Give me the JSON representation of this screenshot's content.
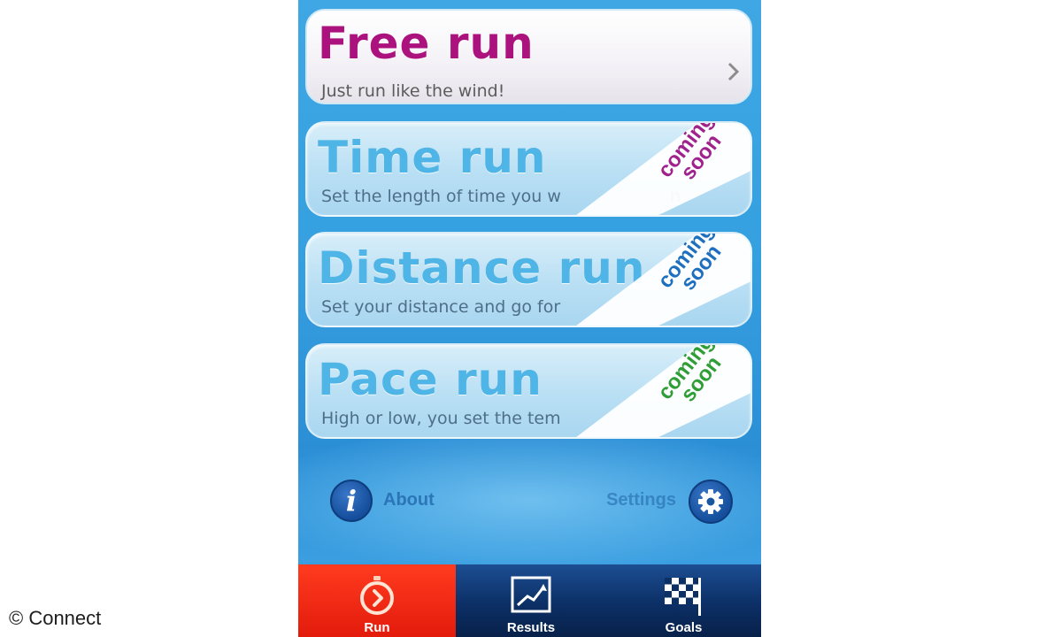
{
  "run_options": [
    {
      "title": "Free run",
      "subtitle": "Just run like the wind!",
      "badge": ""
    },
    {
      "title": "Time run",
      "subtitle": "Set the length of time you w",
      "subtitle_tail": "n",
      "badge": "coming soon",
      "badge_color": "#a0228c"
    },
    {
      "title": "Distance run",
      "subtitle": "Set your distance and go for",
      "badge": "coming soon",
      "badge_color": "#1f6fbf"
    },
    {
      "title": "Pace run",
      "subtitle": "High or low, you set the tem",
      "badge": "coming soon",
      "badge_color": "#2f9e36"
    }
  ],
  "links": {
    "about": "About",
    "settings": "Settings"
  },
  "tabs": [
    {
      "label": "Run",
      "icon": "stopwatch-icon",
      "active": true
    },
    {
      "label": "Results",
      "icon": "chart-icon",
      "active": false
    },
    {
      "label": "Goals",
      "icon": "checkered-flag-icon",
      "active": false
    }
  ],
  "credit": "© Connect",
  "colors": {
    "accent": "#ab127e",
    "active_tab": "#ff3b1f",
    "background": "#35a0e0"
  }
}
